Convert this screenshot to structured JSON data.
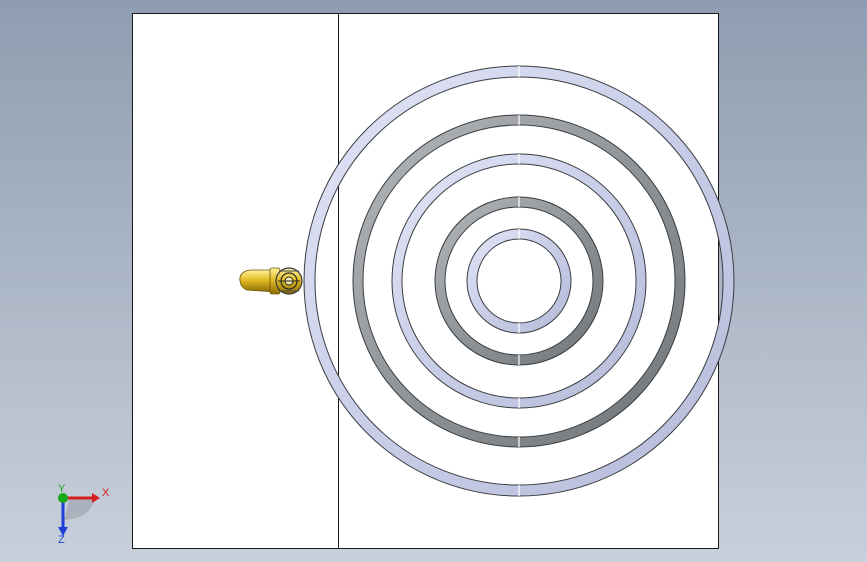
{
  "viewport": {
    "background_top": "#8e9db0",
    "background_bottom": "#c9d0dc"
  },
  "part": {
    "sheet_fill": "#ffffff",
    "sheet_outline": "#1a1a1a",
    "ring_light_color": "#c8cde8",
    "ring_dark_color": "#8a8f93",
    "rings": [
      {
        "shade": "light"
      },
      {
        "shade": "dark"
      },
      {
        "shade": "light"
      },
      {
        "shade": "dark"
      },
      {
        "shade": "light"
      }
    ]
  },
  "feature": {
    "name": "brass-fitting",
    "color": "#d8b21a"
  },
  "triad": {
    "x_label": "X",
    "y_label": "Y",
    "z_label": "Z",
    "x_color": "#d62020",
    "y_color": "#18a818",
    "z_color": "#1c3fd6"
  }
}
